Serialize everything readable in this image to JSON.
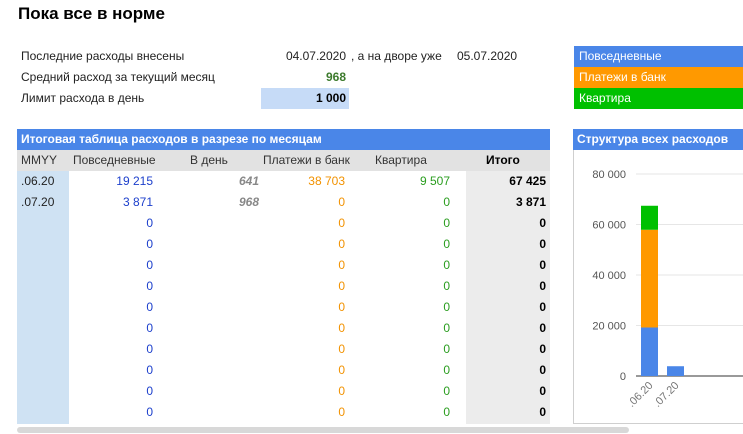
{
  "title": "Пока все в норме",
  "info": {
    "last_label": "Последние расходы внесены",
    "last_date": "04.07.2020",
    "now_label": ", а на дворе уже",
    "now_date": "05.07.2020",
    "avg_label": "Средний расход за текущий месяц",
    "avg_value": "968",
    "limit_label": "Лимит расхода в день",
    "limit_value": "1 000"
  },
  "legend": [
    {
      "label": "Повседневные",
      "color": "#4a86e8"
    },
    {
      "label": "Платежи в банк",
      "color": "#ff9900"
    },
    {
      "label": "Квартира",
      "color": "#00c000"
    }
  ],
  "table": {
    "title": "Итоговая таблица расходов в разрезе по месяцам",
    "headers": [
      "MMYY",
      "Повседневные",
      "В день",
      "Платежи в банк",
      "Квартира",
      "Итого"
    ],
    "rows": [
      {
        "mmyy": ".06.20",
        "daily": "19 215",
        "perday": "641",
        "bank": "38 703",
        "flat": "9 507",
        "total": "67 425"
      },
      {
        "mmyy": ".07.20",
        "daily": "3 871",
        "perday": "968",
        "bank": "0",
        "flat": "0",
        "total": "3 871"
      },
      {
        "mmyy": "",
        "daily": "0",
        "perday": "",
        "bank": "0",
        "flat": "0",
        "total": "0"
      },
      {
        "mmyy": "",
        "daily": "0",
        "perday": "",
        "bank": "0",
        "flat": "0",
        "total": "0"
      },
      {
        "mmyy": "",
        "daily": "0",
        "perday": "",
        "bank": "0",
        "flat": "0",
        "total": "0"
      },
      {
        "mmyy": "",
        "daily": "0",
        "perday": "",
        "bank": "0",
        "flat": "0",
        "total": "0"
      },
      {
        "mmyy": "",
        "daily": "0",
        "perday": "",
        "bank": "0",
        "flat": "0",
        "total": "0"
      },
      {
        "mmyy": "",
        "daily": "0",
        "perday": "",
        "bank": "0",
        "flat": "0",
        "total": "0"
      },
      {
        "mmyy": "",
        "daily": "0",
        "perday": "",
        "bank": "0",
        "flat": "0",
        "total": "0"
      },
      {
        "mmyy": "",
        "daily": "0",
        "perday": "",
        "bank": "0",
        "flat": "0",
        "total": "0"
      },
      {
        "mmyy": "",
        "daily": "0",
        "perday": "",
        "bank": "0",
        "flat": "0",
        "total": "0"
      },
      {
        "mmyy": "",
        "daily": "0",
        "perday": "",
        "bank": "0",
        "flat": "0",
        "total": "0"
      }
    ]
  },
  "chart_data": {
    "type": "bar",
    "stacked": true,
    "title": "Структура всех расходов",
    "categories": [
      ".06.20",
      ".07.20"
    ],
    "series": [
      {
        "name": "Повседневные",
        "color": "#4a86e8",
        "values": [
          19215,
          3871
        ]
      },
      {
        "name": "Платежи в банк",
        "color": "#ff9900",
        "values": [
          38703,
          0
        ]
      },
      {
        "name": "Квартира",
        "color": "#00c000",
        "values": [
          9507,
          0
        ]
      }
    ],
    "yticks": [
      "0",
      "20 000",
      "40 000",
      "60 000",
      "80 000"
    ],
    "ylim": [
      0,
      80000
    ],
    "grid": true
  }
}
